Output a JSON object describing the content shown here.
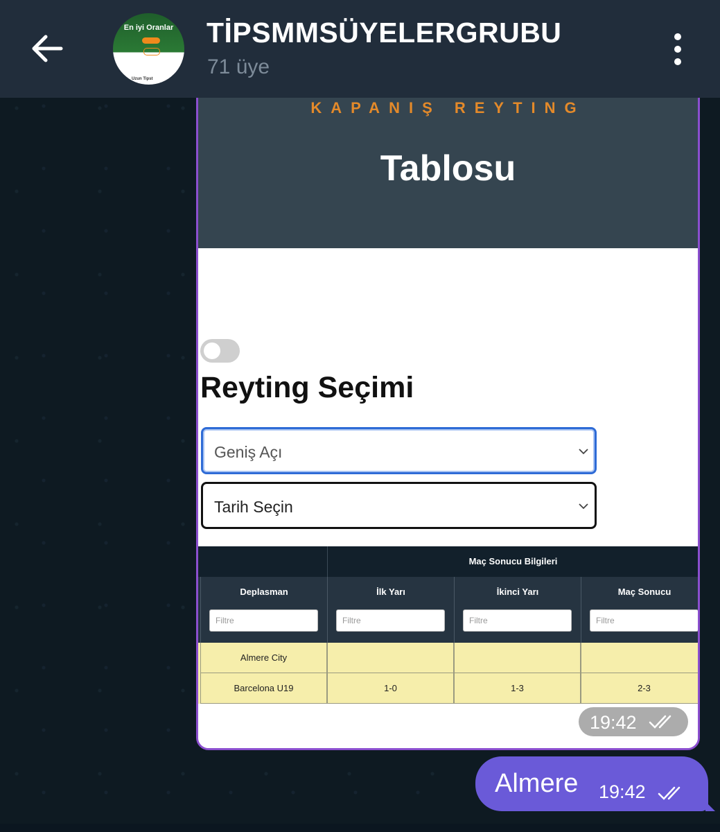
{
  "header": {
    "title": "TİPSMMSÜYELERGRUBU",
    "subtitle": "71 üye",
    "avatar_title": "En iyi Oranlar",
    "avatar_footer": "Uzun Tipst",
    "back_icon": "arrow-left-icon",
    "menu_icon": "more-vertical-icon"
  },
  "image_message": {
    "hero_kicker": "KAPANIŞ REYTING",
    "hero_title": "Tablosu",
    "section_title": "Reyting Seçimi",
    "select1_value": "Geniş Açı",
    "select2_value": "Tarih Seçin",
    "table": {
      "group_header": "Maç Sonucu Bilgileri",
      "columns": [
        "Deplasman",
        "İlk Yarı",
        "İkinci Yarı",
        "Maç Sonucu"
      ],
      "filter_placeholder": "Filtre",
      "rows": [
        [
          "Almere City",
          "",
          "",
          ""
        ],
        [
          "Barcelona U19",
          "1-0",
          "1-3",
          "2-3"
        ]
      ]
    },
    "time": "19:42"
  },
  "outgoing_message": {
    "text": "Almere",
    "time": "19:42"
  },
  "colors": {
    "header_bg": "#212d3b",
    "outgoing_bubble": "#6a5ad8",
    "hero_bg": "#354550",
    "kicker": "#e48a2a",
    "row_highlight": "#f6eeab"
  }
}
